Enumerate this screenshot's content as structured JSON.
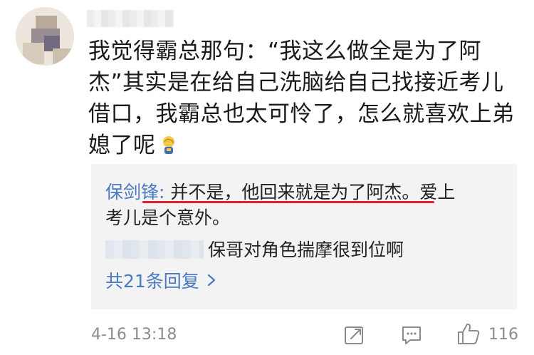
{
  "comment": {
    "text_lines": [
      "我觉得霸总那句：“我这么做全是为了阿",
      "杰”其实是在给自己洗脑给自己找接近考儿",
      "借口，我霸总也太可怜了，怎么就喜欢上弟",
      "媳了呢"
    ],
    "emoji_icon": "facepalm-emoji-icon"
  },
  "replies": [
    {
      "author": "保剑锋",
      "separator": ": ",
      "text_line1": "并不是，他回来就是为了阿杰。爱上",
      "text_line2": "考儿是个意外。"
    },
    {
      "text": "保哥对角色揣摩很到位啊"
    }
  ],
  "more_replies": {
    "label": "共21条回复",
    "icon": "chevron-right-icon"
  },
  "footer": {
    "timestamp": "4-16 13:18",
    "repost_icon": "repost-icon",
    "comment_icon": "comment-icon",
    "like_icon": "thumbs-up-icon",
    "like_count": "116"
  },
  "colors": {
    "link_blue": "#4a79c4",
    "underline_red": "#d8232a",
    "meta_gray": "#8c8c8c",
    "reply_bg": "#f3f3f3"
  }
}
